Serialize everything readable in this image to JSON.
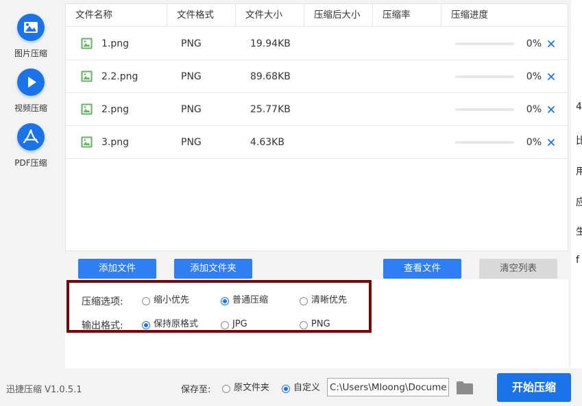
{
  "sidebar": {
    "items": [
      {
        "label": "图片压缩",
        "icon": "image-icon"
      },
      {
        "label": "视频压缩",
        "icon": "play-icon"
      },
      {
        "label": "PDF压缩",
        "icon": "pdf-icon"
      }
    ]
  },
  "table": {
    "headers": [
      "文件名称",
      "文件格式",
      "文件大小",
      "压缩后大小",
      "压缩率",
      "压缩进度"
    ],
    "rows": [
      {
        "name": "1.png",
        "format": "PNG",
        "size": "19.94KB",
        "compressed": "",
        "ratio": "",
        "progress": 0,
        "progress_text": "0%"
      },
      {
        "name": "2.2.png",
        "format": "PNG",
        "size": "89.68KB",
        "compressed": "",
        "ratio": "",
        "progress": 0,
        "progress_text": "0%"
      },
      {
        "name": "2.png",
        "format": "PNG",
        "size": "25.77KB",
        "compressed": "",
        "ratio": "",
        "progress": 0,
        "progress_text": "0%"
      },
      {
        "name": "3.png",
        "format": "PNG",
        "size": "4.63KB",
        "compressed": "",
        "ratio": "",
        "progress": 0,
        "progress_text": "0%"
      }
    ]
  },
  "actions": {
    "add_file": "添加文件",
    "add_folder": "添加文件夹",
    "view_files": "查看文件",
    "clear_list": "清空列表"
  },
  "options": {
    "compress_label": "压缩选项:",
    "compress_choices": [
      "缩小优先",
      "普通压缩",
      "清晰优先"
    ],
    "compress_selected": "普通压缩",
    "format_label": "输出格式:",
    "format_choices": [
      "保持原格式",
      "JPG",
      "PNG"
    ],
    "format_selected": "保持原格式"
  },
  "footer": {
    "version": "迅捷压缩 V1.0.5.1",
    "save_to_label": "保存至:",
    "save_choices": [
      "原文件夹",
      "自定义"
    ],
    "save_selected": "自定义",
    "path": "C:\\Users\\Mloong\\Documents",
    "start_button": "开始压缩"
  },
  "background_text": [
    "4",
    "比",
    "用",
    "应",
    "生",
    "f"
  ],
  "colors": {
    "accent": "#1a73e8",
    "button_blue": "#2f7ef3",
    "highlight_border": "#7a0000",
    "file_icon_green": "#5bb75b"
  }
}
